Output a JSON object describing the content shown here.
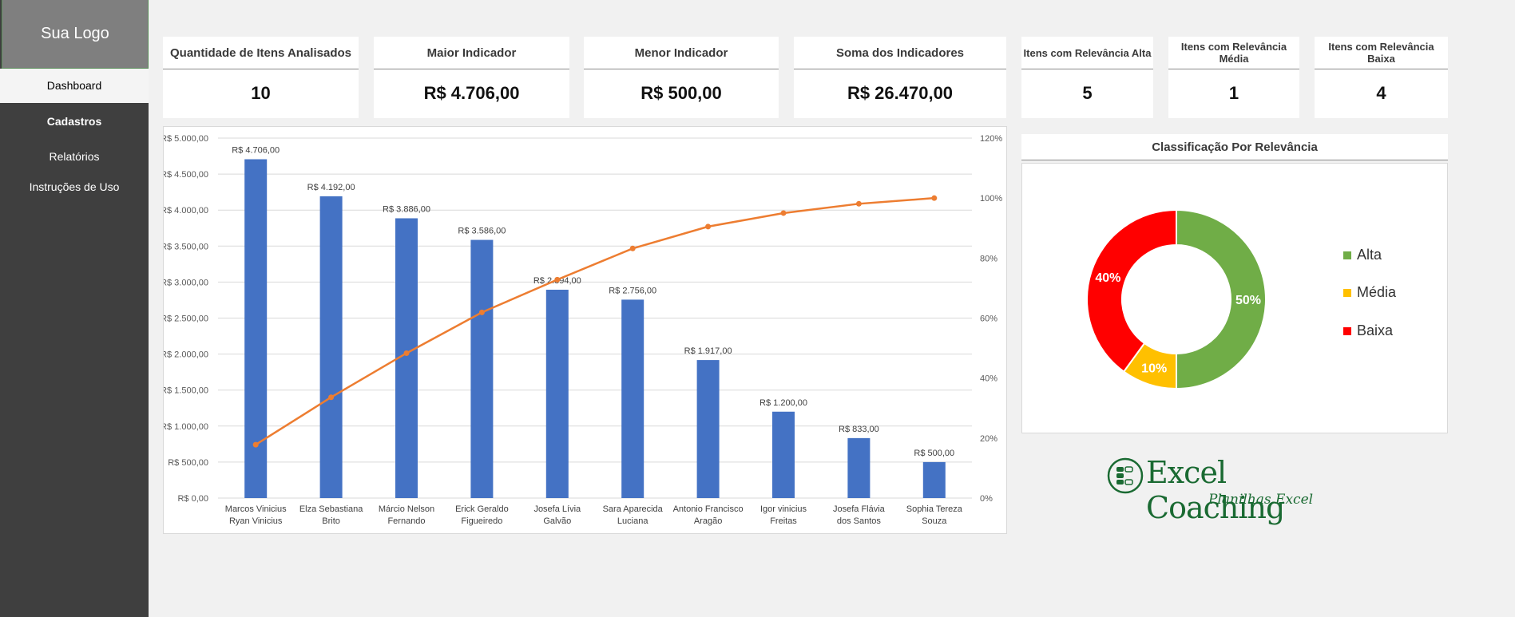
{
  "sidebar": {
    "logo": "Sua Logo",
    "items": [
      {
        "label": "Dashboard"
      },
      {
        "label": "Cadastros"
      },
      {
        "label": "Relatórios"
      },
      {
        "label": "Instruções de Uso"
      }
    ]
  },
  "kpis": [
    {
      "title": "Quantidade de Itens Analisados",
      "value": "10"
    },
    {
      "title": "Maior Indicador",
      "value": "R$ 4.706,00"
    },
    {
      "title": "Menor Indicador",
      "value": "R$ 500,00"
    },
    {
      "title": "Soma dos Indicadores",
      "value": "R$ 26.470,00"
    },
    {
      "title": "Itens com Relevância Alta",
      "value": "5"
    },
    {
      "title": "Itens com Relevância Média",
      "value": "1"
    },
    {
      "title": "Itens com Relevância Baixa",
      "value": "4"
    }
  ],
  "chart_data": [
    {
      "type": "bar",
      "title": "",
      "categories": [
        "Marcos Vinicius Ryan Vinicius",
        "Elza Sebastiana Brito",
        "Márcio Nelson Fernando",
        "Erick Geraldo Figueiredo",
        "Josefa Lívia Galvão",
        "Sara Aparecida Luciana",
        "Antonio Francisco Aragão",
        "Igor vinicius Freitas",
        "Josefa Flávia dos Santos",
        "Sophia Tereza Souza"
      ],
      "series": [
        {
          "values": [
            4706,
            4192,
            3886,
            3586,
            2894,
            2756,
            1917,
            1200,
            833,
            500
          ],
          "labels": [
            "R$ 4.706,00",
            "R$ 4.192,00",
            "R$ 3.886,00",
            "R$ 3.586,00",
            "R$ 2.894,00",
            "R$ 2.756,00",
            "R$ 1.917,00",
            "R$ 1.200,00",
            "R$ 833,00",
            "R$ 500,00"
          ],
          "color": "#4472c4"
        },
        {
          "values": [
            17.8,
            33.6,
            48.3,
            61.9,
            72.8,
            83.2,
            90.5,
            95.0,
            98.1,
            100
          ],
          "color": "#ed7d31",
          "axis": "right",
          "kind": "line"
        }
      ],
      "ylim": [
        0,
        5000
      ],
      "yticks": [
        "R$ 0,00",
        "R$ 500,00",
        "R$ 1.000,00",
        "R$ 1.500,00",
        "R$ 2.000,00",
        "R$ 2.500,00",
        "R$ 3.000,00",
        "R$ 3.500,00",
        "R$ 4.000,00",
        "R$ 4.500,00",
        "R$ 5.000,00"
      ],
      "y2lim": [
        0,
        120
      ],
      "y2ticks": [
        "0%",
        "20%",
        "40%",
        "60%",
        "80%",
        "100%",
        "120%"
      ],
      "grid": true
    },
    {
      "type": "pie",
      "title": "Classificação Por Relevância",
      "categories": [
        "Alta",
        "Média",
        "Baixa"
      ],
      "values": [
        50,
        10,
        40
      ],
      "labels": [
        "50%",
        "10%",
        "40%"
      ],
      "colors": [
        "#70ad47",
        "#ffc000",
        "#ff0000"
      ],
      "legend": "right"
    }
  ],
  "brand": {
    "name": "Excel Coaching",
    "subtitle": "Planilhas Excel"
  }
}
